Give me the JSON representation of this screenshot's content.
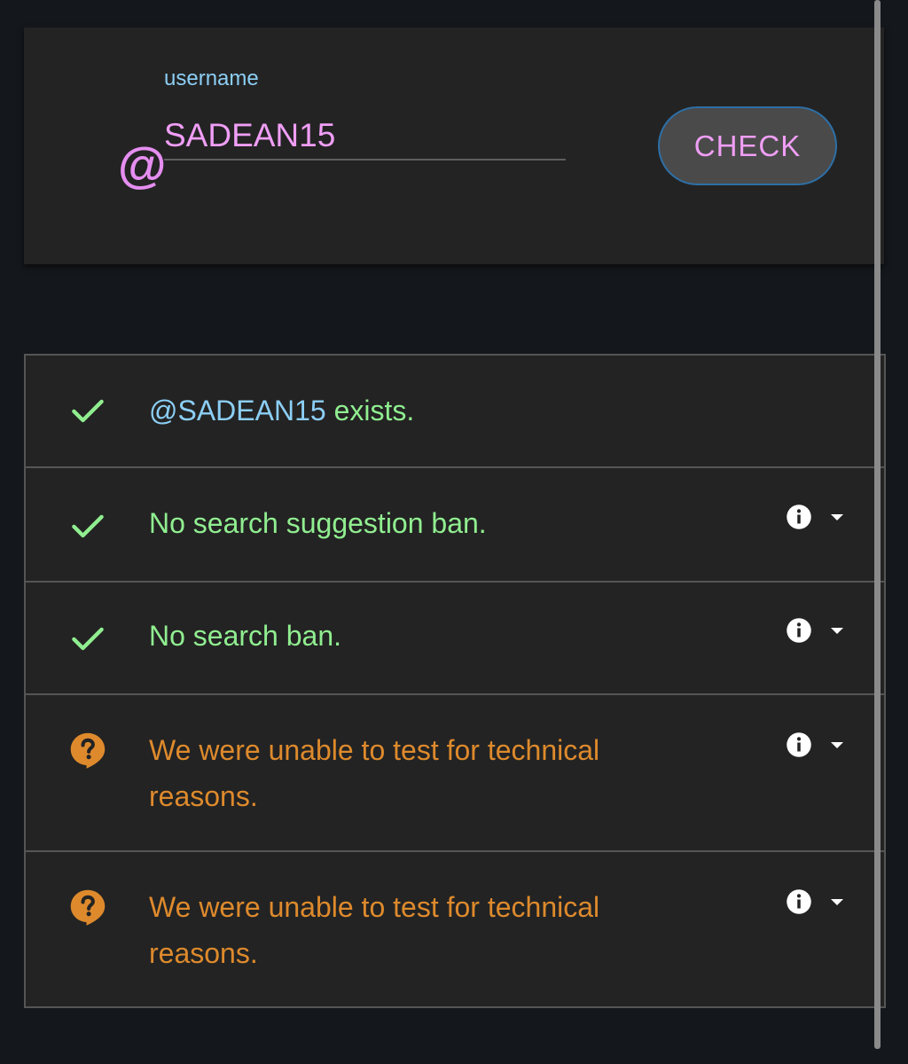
{
  "search": {
    "at_symbol": "@",
    "label": "username",
    "value": "SADEAN15",
    "check_label": "CHECK"
  },
  "results": [
    {
      "status": "check",
      "icon": "check-icon",
      "handle": "@SADEAN15",
      "text": " exists.",
      "has_details": false
    },
    {
      "status": "check",
      "icon": "check-icon",
      "text": "No search suggestion ban.",
      "has_details": true
    },
    {
      "status": "check",
      "icon": "check-icon",
      "text": "No search ban.",
      "has_details": true
    },
    {
      "status": "unknown",
      "icon": "question-bubble-icon",
      "text_line1": "We were unable to test for technical",
      "text_line2": "reasons.",
      "has_details": true
    },
    {
      "status": "unknown",
      "icon": "question-bubble-icon",
      "text_line1": "We were unable to test for technical",
      "text_line2": "reasons.",
      "has_details": true
    }
  ],
  "colors": {
    "background": "#14171b",
    "card": "#232323",
    "accent_pink": "#f09ef6",
    "label_blue": "#8ccff5",
    "ok_green": "#90ee90",
    "warn_orange": "#de8a2c"
  }
}
